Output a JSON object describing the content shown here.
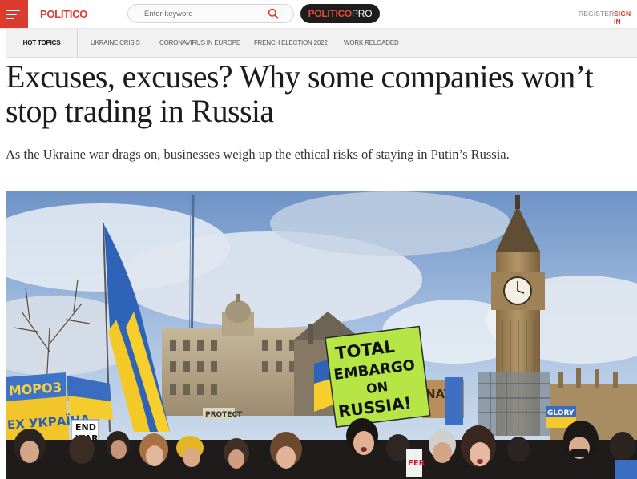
{
  "header": {
    "brand": "POLITICO",
    "search_placeholder": "Enter keyword",
    "pro_part1": "POLITICO",
    "pro_part2": "PRO",
    "register": "REGISTER",
    "signin": "SIGN IN",
    "accent_color": "#dc3b30"
  },
  "topics": {
    "hot_label": "HOT TOPICS",
    "items": [
      {
        "label": "UKRAINE CRISIS"
      },
      {
        "label": "CORONAVIRUS IN EUROPE"
      },
      {
        "label": "FRENCH ELECTION 2022"
      },
      {
        "label": "WORK RELOADED"
      }
    ]
  },
  "article": {
    "headline": "Excuses, excuses? Why some companies won’t stop trading in Russia",
    "dek": "As the Ukraine war drags on, businesses weigh up the ethical risks of staying in Putin’s Russia."
  },
  "hero": {
    "sign_main": [
      "TOTAL",
      "EMBARGO",
      "ON",
      "RUSSIA!"
    ],
    "sign_left": [
      "МОРОЗ",
      "ЕХ УКРАЇНА"
    ],
    "sign_end_war": [
      "END",
      "WAR"
    ],
    "sign_protect": "PROTECT",
    "sign_nato": "NATO",
    "sign_glory": "GLORY",
    "sign_fer": "FER"
  }
}
